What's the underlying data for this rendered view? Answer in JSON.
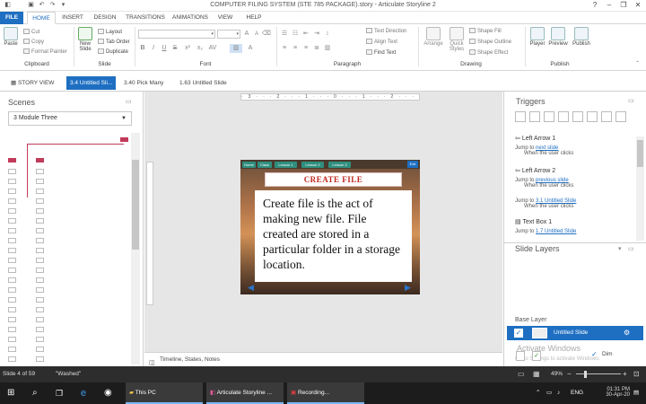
{
  "window": {
    "title": "COMPUTER FILING SYSTEM (STE 785 PACKAGE).story - Articulate Storyline 2",
    "quick_access": [
      "save-icon",
      "undo-icon",
      "redo-icon"
    ],
    "controls": [
      "?",
      "–",
      "❐",
      "✕"
    ]
  },
  "ribbon_tabs": [
    "FILE",
    "HOME",
    "INSERT",
    "DESIGN",
    "TRANSITIONS",
    "ANIMATIONS",
    "VIEW",
    "HELP"
  ],
  "ribbon": {
    "clipboard": {
      "paste": "Paste",
      "cut": "Cut",
      "copy": "Copy",
      "format_painter": "Format Painter",
      "group": "Clipboard"
    },
    "slide": {
      "new_slide": "New Slide",
      "layout": "Layout",
      "tab_order": "Tab Order",
      "duplicate": "Duplicate",
      "group": "Slide"
    },
    "font": {
      "group": "Font",
      "bold": "B",
      "italic": "I",
      "underline": "U",
      "strike": "S"
    },
    "paragraph": {
      "text_direction": "Text Direction",
      "align_text": "Align Text",
      "find_text": "Find Text",
      "group": "Paragraph"
    },
    "drawing": {
      "arrange": "Arrange",
      "quick_styles": "Quick Styles",
      "shape_fill": "Shape Fill",
      "shape_outline": "Shape Outline",
      "shape_effect": "Shape Effect",
      "group": "Drawing"
    },
    "publish": {
      "player": "Player",
      "preview": "Preview",
      "publish": "Publish",
      "group": "Publish"
    }
  },
  "doc_tabs": [
    "STORY VIEW",
    "3.4 Untitled Sli...",
    "3.40 Pick Many",
    "1.63 Untitled Slide"
  ],
  "scenes": {
    "header": "Scenes",
    "selected": "3 Module Three"
  },
  "slide": {
    "nav": [
      "Home",
      "Class",
      "Lesson 1",
      "Lesson 2",
      "Lesson 3"
    ],
    "exit": "Exit",
    "title": "CREATE FILE",
    "body": "Create file is the act of making new file. File created are stored in a particular folder in a storage location."
  },
  "timeline_label": "Timeline, States, Notes",
  "triggers": {
    "header": "Triggers",
    "items": [
      {
        "name": "Left Arrow 1",
        "jump": "Jump to",
        "target": "next slide",
        "when": "When the user clicks"
      },
      {
        "name": "Left Arrow 2",
        "jump": "Jump to",
        "target": "previous slide",
        "when": "When the user clicks"
      },
      {
        "name": "",
        "jump": "Jump to",
        "target": "3.1 Untitled Slide",
        "when": "When the user clicks"
      },
      {
        "name": "Text Box 1",
        "jump": "Jump to",
        "target": "1.7 Untitled Slide",
        "when": ""
      }
    ]
  },
  "slide_layers": {
    "header": "Slide Layers",
    "base_label": "Base Layer",
    "base_layer": "Untitled Slide",
    "dim": "Dim"
  },
  "watermark": {
    "line1": "Activate Windows",
    "line2": "Go to Settings to activate Windows."
  },
  "status": {
    "slide_info": "Slide 4 of 59",
    "theme": "\"Washed\"",
    "zoom": "49%"
  },
  "taskbar": {
    "search_icon": "search-icon",
    "apps": [
      "This PC",
      "Articulate Storyline ...",
      "Recording..."
    ],
    "lang": "ENG",
    "time": "01:31 PM",
    "date": "30-Apr-20"
  },
  "colors": {
    "accent": "#1e6fc2",
    "title_red": "#c0281e",
    "taskbar": "#1c1c1c"
  }
}
